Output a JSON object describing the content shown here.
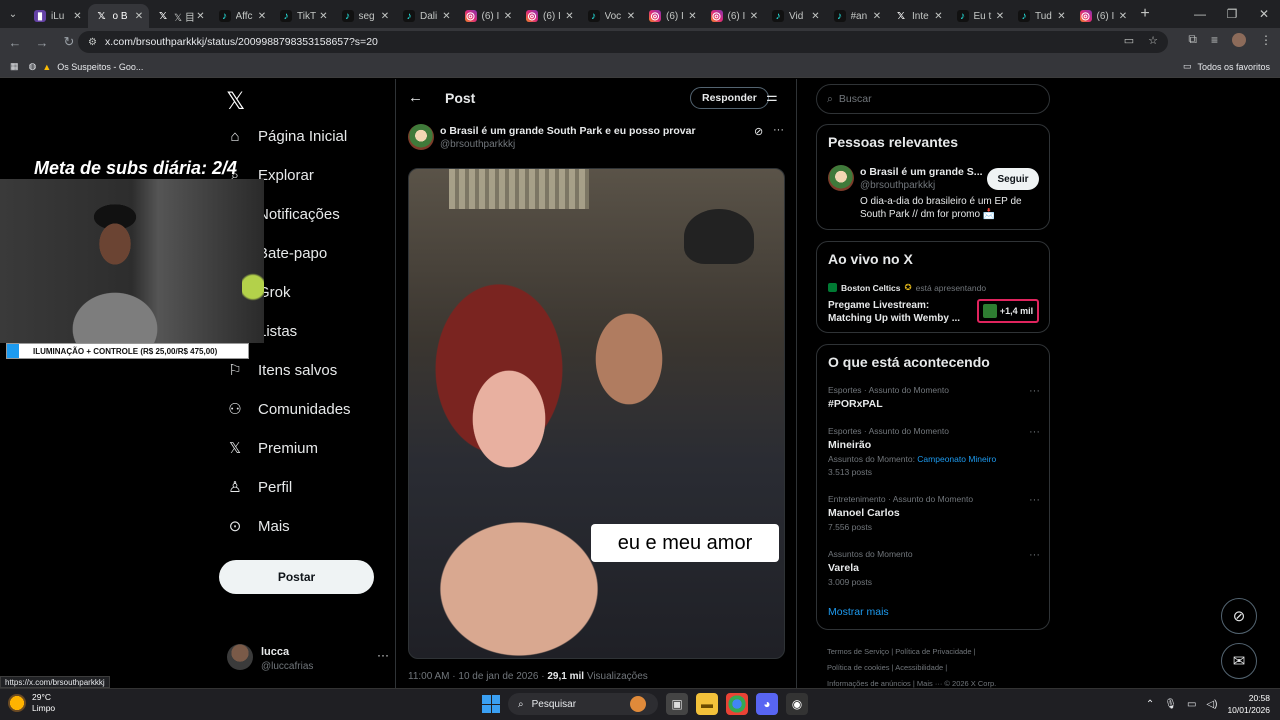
{
  "browser": {
    "tabs": [
      {
        "title": "iLu",
        "favicon": "twitch-icon",
        "active": false
      },
      {
        "title": "o B",
        "favicon": "x-icon",
        "active": true
      },
      {
        "title": "𝕏 目 目",
        "favicon": "x-icon",
        "active": false
      },
      {
        "title": "Affc",
        "favicon": "tiktok-icon",
        "active": false
      },
      {
        "title": "TikT",
        "favicon": "tiktok-icon",
        "active": false
      },
      {
        "title": "seg",
        "favicon": "tiktok-icon",
        "active": false
      },
      {
        "title": "Dali",
        "favicon": "tiktok-icon",
        "active": false
      },
      {
        "title": "(6) I",
        "favicon": "instagram-icon",
        "active": false
      },
      {
        "title": "(6) I",
        "favicon": "instagram-icon",
        "active": false
      },
      {
        "title": "Voc",
        "favicon": "tiktok-icon",
        "active": false
      },
      {
        "title": "(6) I",
        "favicon": "instagram-icon",
        "active": false
      },
      {
        "title": "(6) I",
        "favicon": "instagram-icon",
        "active": false
      },
      {
        "title": "Vid",
        "favicon": "tiktok-icon",
        "active": false
      },
      {
        "title": "#an",
        "favicon": "tiktok-icon",
        "active": false
      },
      {
        "title": "Inte",
        "favicon": "x-icon",
        "active": false
      },
      {
        "title": "Eu t",
        "favicon": "tiktok-icon",
        "active": false
      },
      {
        "title": "Tud",
        "favicon": "tiktok-icon",
        "active": false
      },
      {
        "title": "(6) I",
        "favicon": "instagram-icon",
        "active": false
      }
    ],
    "url": "x.com/brsouthparkkkj/status/2009988798353158657?s=20",
    "bookmark": "Os Suspeitos - Goo...",
    "all_bookmarks": "Todos os favoritos",
    "status_url": "https://x.com/brsouthparkkkj"
  },
  "nav": {
    "items": [
      {
        "label": "Página Inicial",
        "icon": "home-icon"
      },
      {
        "label": "Explorar",
        "icon": "search-icon"
      },
      {
        "label": "Notificações",
        "icon": "bell-icon"
      },
      {
        "label": "Bate-papo",
        "icon": "chat-icon"
      },
      {
        "label": "Grok",
        "icon": "grok-icon"
      },
      {
        "label": "Listas",
        "icon": "list-icon"
      },
      {
        "label": "Itens salvos",
        "icon": "bookmark-icon"
      },
      {
        "label": "Comunidades",
        "icon": "community-icon"
      },
      {
        "label": "Premium",
        "icon": "x-icon"
      },
      {
        "label": "Perfil",
        "icon": "person-icon"
      },
      {
        "label": "Mais",
        "icon": "more-circle-icon"
      }
    ],
    "post_button": "Postar",
    "account": {
      "name": "lucca",
      "handle": "@luccafrias"
    }
  },
  "post": {
    "header_title": "Post",
    "reply_label": "Responder",
    "author_name": "o Brasil é um grande South Park e eu posso provar",
    "author_handle": "@brsouthparkkkj",
    "caption": "eu e meu amor",
    "time": "11:00 AM · 10 de jan de 2026 · ",
    "views": "29,1 mil",
    "views_label": " Visualizações"
  },
  "sidebar": {
    "search_placeholder": "Buscar",
    "relevant": {
      "title": "Pessoas relevantes",
      "name": "o Brasil é um grande S...",
      "handle": "@brsouthparkkkj",
      "bio": "O dia-a-dia do brasileiro é um EP de South Park // dm for promo 📩",
      "follow": "Seguir"
    },
    "live": {
      "title": "Ao vivo no X",
      "host": "Boston Celtics",
      "host_suffix": "está apresentando",
      "stream_title": "Pregame Livestream: Matching Up with Wemby ...",
      "count": "+1,4 mil"
    },
    "trends": {
      "title": "O que está acontecendo",
      "items": [
        {
          "category": "Esportes · Assunto do Momento",
          "name": "#PORxPAL",
          "sub": ""
        },
        {
          "category": "Esportes · Assunto do Momento",
          "name": "Mineirão",
          "sub": "Assuntos do Momento: ",
          "link": "Campeonato Mineiro",
          "posts": "3.513 posts"
        },
        {
          "category": "Entretenimento · Assunto do Momento",
          "name": "Manoel Carlos",
          "sub": "7.556 posts"
        },
        {
          "category": "Assuntos do Momento",
          "name": "Varela",
          "sub": "3.009 posts"
        }
      ],
      "show_more": "Mostrar mais"
    },
    "footer": {
      "line1": "Termos de Serviço  |  Política de Privacidade  |",
      "line2": "Política de cookies  |  Acessibilidade  |",
      "line3": "Informações de anúncios  |  Mais ···  © 2026 X Corp."
    }
  },
  "overlay": {
    "goal_text": "Meta de subs diária: 2/4",
    "bar_text": "ILUMINAÇÃO + CONTROLE (R$ 25,00/R$ 475,00)",
    "bar_progress": 0.05
  },
  "taskbar": {
    "temp": "29°C",
    "weather": "Limpo",
    "search": "Pesquisar",
    "time": "20:58",
    "date": "10/01/2026"
  }
}
